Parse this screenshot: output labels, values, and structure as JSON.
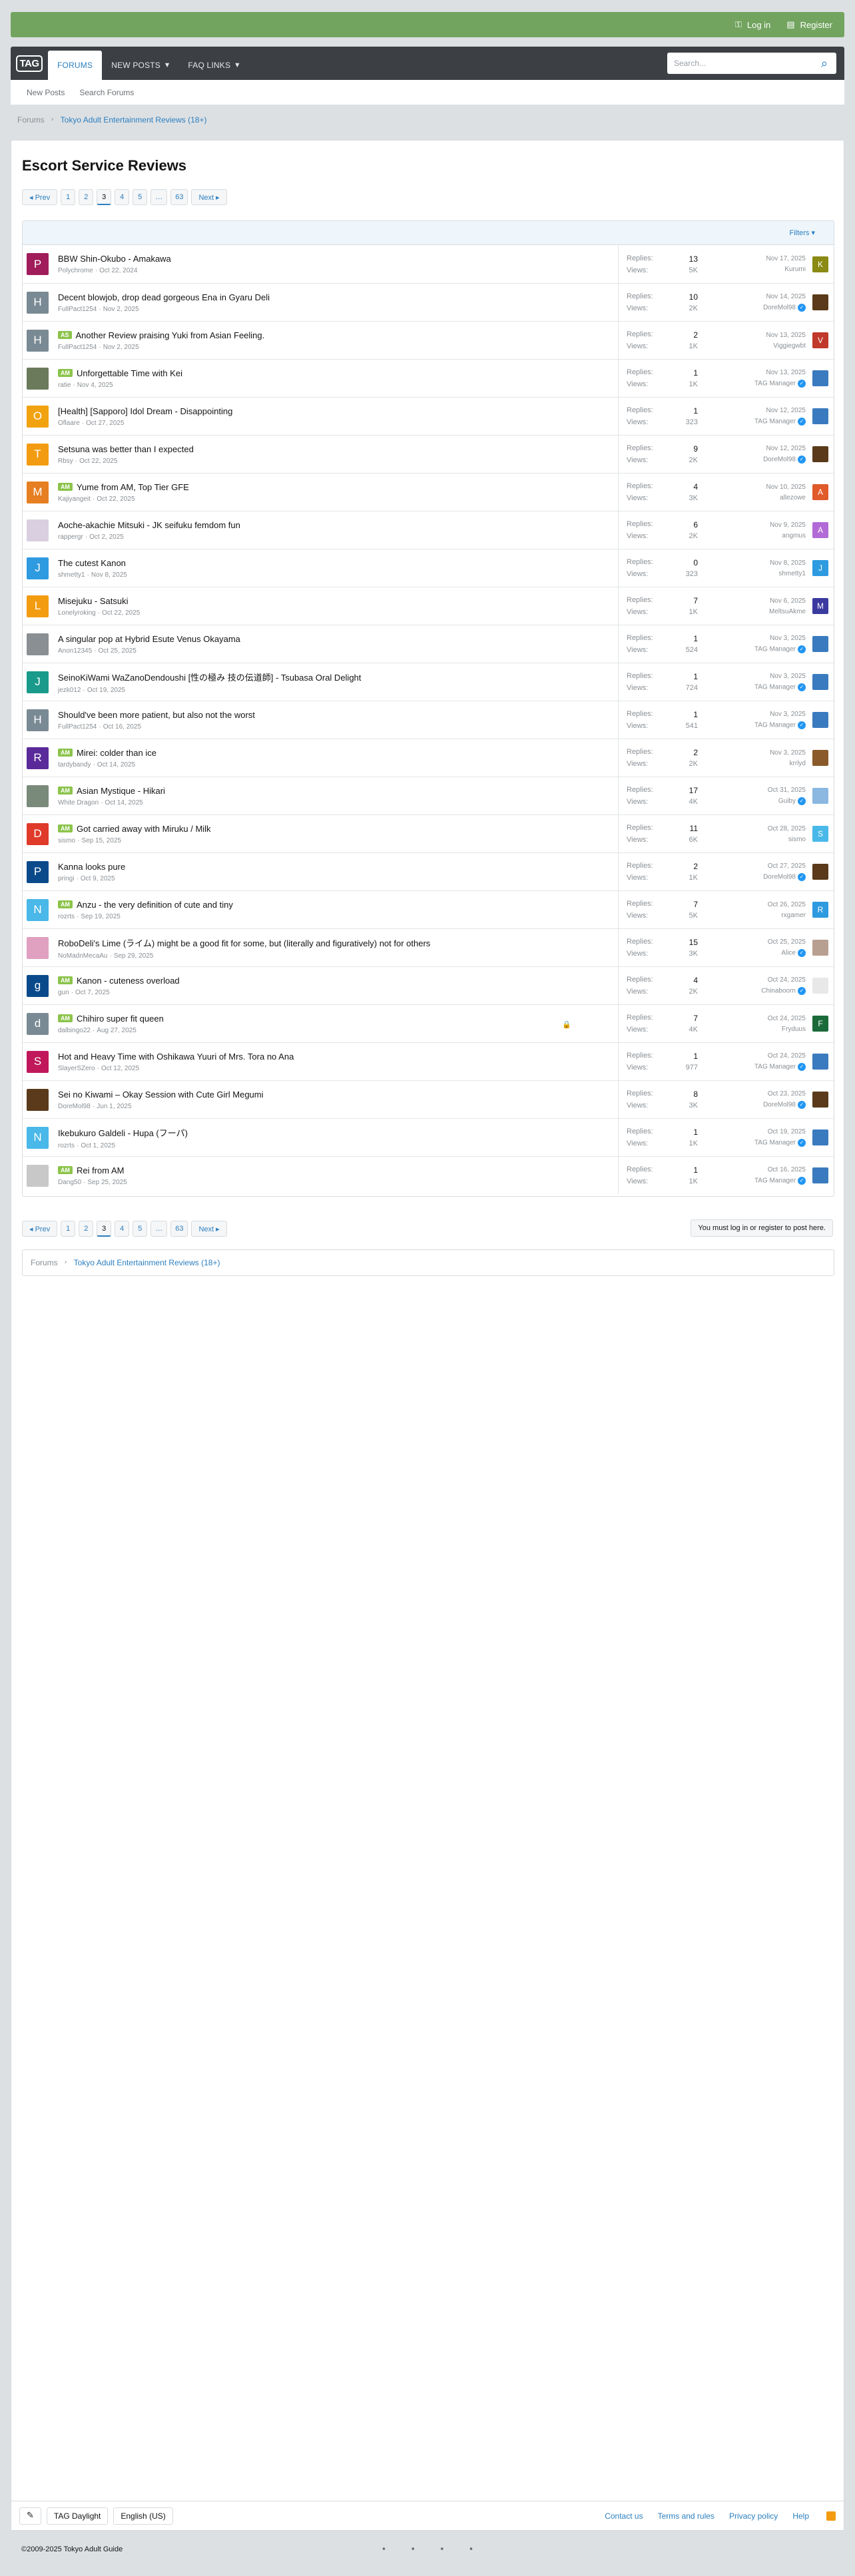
{
  "topbar": {
    "login": "Log in",
    "register": "Register",
    "login_icon": "key-icon",
    "register_icon": "register-icon"
  },
  "nav": {
    "logo": "TAG",
    "tabs": [
      {
        "label": "FORUMS",
        "selected": true
      },
      {
        "label": "NEW POSTS",
        "dropdown": true
      },
      {
        "label": "FAQ LINKS",
        "dropdown": true
      }
    ],
    "search_placeholder": "Search..."
  },
  "subnav": {
    "items": [
      "New Posts",
      "Search Forums"
    ]
  },
  "breadcrumb": {
    "root": "Forums",
    "current": "Tokyo Adult Entertainment Reviews (18+)"
  },
  "page": {
    "title": "Escort Service Reviews"
  },
  "pagination": {
    "prev": "◂ Prev",
    "pages": [
      "1",
      "2",
      "3",
      "4",
      "5",
      "…",
      "63"
    ],
    "current": "3",
    "next": "Next ▸"
  },
  "filters": {
    "label": "Filters ▾"
  },
  "labels": {
    "replies": "Replies:",
    "views": "Views:",
    "login_note": "You must log in or register to post here."
  },
  "threads": [
    {
      "title": "BBW Shin-Okubo - Amakawa",
      "tag": "",
      "author": "Polychrome",
      "date": "Oct 22, 2024",
      "replies": "13",
      "views": "5K",
      "last_date": "Nov 17, 2025",
      "last_user": "Kurumi",
      "verified": false,
      "av_letter": "P",
      "av_color": "#a01c5a",
      "av2_letter": "K",
      "av2_color": "#8a8a14",
      "locked": false
    },
    {
      "title": "Decent blowjob, drop dead gorgeous Ena in Gyaru Deli",
      "tag": "",
      "author": "FullPact1254",
      "date": "Nov 2, 2025",
      "replies": "10",
      "views": "2K",
      "last_date": "Nov 14, 2025",
      "last_user": "DoreMol98",
      "verified": true,
      "av_letter": "H",
      "av_color": "#7a8a94",
      "av2_letter": "",
      "av2_color": "#5a3a1a",
      "locked": false
    },
    {
      "title": "Another Review praising Yuki from Asian Feeling.",
      "tag": "AS",
      "author": "FullPact1254",
      "date": "Nov 2, 2025",
      "replies": "2",
      "views": "1K",
      "last_date": "Nov 13, 2025",
      "last_user": "Viggiegwbt",
      "verified": false,
      "av_letter": "H",
      "av_color": "#7a8a94",
      "av2_letter": "V",
      "av2_color": "#c0392b",
      "locked": false
    },
    {
      "title": "Unforgettable Time with Kei",
      "tag": "AM",
      "author": "ratie",
      "date": "Nov 4, 2025",
      "replies": "1",
      "views": "1K",
      "last_date": "Nov 13, 2025",
      "last_user": "TAG Manager",
      "verified": true,
      "av_letter": "",
      "av_color": "#6b7a5a",
      "av2_letter": "",
      "av2_color": "#3a7abf",
      "locked": false
    },
    {
      "title": "[Health] [Sapporo] Idol Dream - Disappointing",
      "tag": "",
      "author": "Oflaare",
      "date": "Oct 27, 2025",
      "replies": "1",
      "views": "323",
      "last_date": "Nov 12, 2025",
      "last_user": "TAG Manager",
      "verified": true,
      "av_letter": "O",
      "av_color": "#f1a20f",
      "av2_letter": "",
      "av2_color": "#3a7abf",
      "locked": false
    },
    {
      "title": "Setsuna was better than I expected",
      "tag": "",
      "author": "Rbsy",
      "date": "Oct 22, 2025",
      "replies": "9",
      "views": "2K",
      "last_date": "Nov 12, 2025",
      "last_user": "DoreMol98",
      "verified": true,
      "av_letter": "T",
      "av_color": "#f39c12",
      "av2_letter": "",
      "av2_color": "#5a3a1a",
      "locked": false
    },
    {
      "title": "Yume from AM, Top Tier GFE",
      "tag": "AM",
      "author": "Kajiyangeit",
      "date": "Oct 22, 2025",
      "replies": "4",
      "views": "3K",
      "last_date": "Nov 10, 2025",
      "last_user": "allezowe",
      "verified": false,
      "av_letter": "M",
      "av_color": "#e67e22",
      "av2_letter": "A",
      "av2_color": "#e05a2a",
      "locked": false
    },
    {
      "title": "Aoche-akachie Mitsuki - JK seifuku femdom fun",
      "tag": "",
      "author": "rappergr",
      "date": "Oct 2, 2025",
      "replies": "6",
      "views": "2K",
      "last_date": "Nov 9, 2025",
      "last_user": "angmus",
      "verified": false,
      "av_letter": "",
      "av_color": "#d9cfe0",
      "av2_letter": "A",
      "av2_color": "#b26ad6",
      "locked": false
    },
    {
      "title": "The cutest Kanon",
      "tag": "",
      "author": "shmetty1",
      "date": "Nov 8, 2025",
      "replies": "0",
      "views": "323",
      "last_date": "Nov 8, 2025",
      "last_user": "shmetty1",
      "verified": false,
      "av_letter": "J",
      "av_color": "#2e9ae0",
      "av2_letter": "J",
      "av2_color": "#2e9ae0",
      "locked": false
    },
    {
      "title": "Misejuku - Satsuki",
      "tag": "",
      "author": "Lonelyroking",
      "date": "Oct 22, 2025",
      "replies": "7",
      "views": "1K",
      "last_date": "Nov 6, 2025",
      "last_user": "MeltsuAkme",
      "verified": false,
      "av_letter": "L",
      "av_color": "#f39c12",
      "av2_letter": "M",
      "av2_color": "#3a3aa0",
      "locked": false
    },
    {
      "title": "A singular pop at Hybrid Esute Venus Okayama",
      "tag": "",
      "author": "Anon12345",
      "date": "Oct 25, 2025",
      "replies": "1",
      "views": "524",
      "last_date": "Nov 3, 2025",
      "last_user": "TAG Manager",
      "verified": true,
      "av_letter": "",
      "av_color": "#8a8f94",
      "av2_letter": "",
      "av2_color": "#3a7abf",
      "locked": false
    },
    {
      "title": "SeinoKiWami WaZanoDendoushi [性の極み 技の伝道師] - Tsubasa Oral Delight",
      "tag": "",
      "author": "jezk012",
      "date": "Oct 19, 2025",
      "replies": "1",
      "views": "724",
      "last_date": "Nov 3, 2025",
      "last_user": "TAG Manager",
      "verified": true,
      "av_letter": "J",
      "av_color": "#1a9a8a",
      "av2_letter": "",
      "av2_color": "#3a7abf",
      "locked": false
    },
    {
      "title": "Should've been more patient, but also not the worst",
      "tag": "",
      "author": "FullPact1254",
      "date": "Oct 16, 2025",
      "replies": "1",
      "views": "541",
      "last_date": "Nov 3, 2025",
      "last_user": "TAG Manager",
      "verified": true,
      "av_letter": "H",
      "av_color": "#7a8a94",
      "av2_letter": "",
      "av2_color": "#3a7abf",
      "locked": false
    },
    {
      "title": "Mirei: colder than ice",
      "tag": "AM",
      "author": "tardybandy",
      "date": "Oct 14, 2025",
      "replies": "2",
      "views": "2K",
      "last_date": "Nov 3, 2025",
      "last_user": "krrlyd",
      "verified": false,
      "av_letter": "R",
      "av_color": "#5a2a9a",
      "av2_letter": "",
      "av2_color": "#8a5a2a",
      "locked": false
    },
    {
      "title": "Asian Mystique - Hikari",
      "tag": "AM",
      "author": "White Dragon",
      "date": "Oct 14, 2025",
      "replies": "17",
      "views": "4K",
      "last_date": "Oct 31, 2025",
      "last_user": "Guiby",
      "verified": true,
      "av_letter": "",
      "av_color": "#7a8a7a",
      "av2_letter": "",
      "av2_color": "#8ab8e0",
      "locked": false
    },
    {
      "title": "Got carried away with Miruku / Milk",
      "tag": "AM",
      "author": "sismo",
      "date": "Sep 15, 2025",
      "replies": "11",
      "views": "6K",
      "last_date": "Oct 28, 2025",
      "last_user": "sismo",
      "verified": false,
      "av_letter": "D",
      "av_color": "#e03a2a",
      "av2_letter": "S",
      "av2_color": "#4ab8e8",
      "locked": false
    },
    {
      "title": "Kanna looks pure",
      "tag": "",
      "author": "pringi",
      "date": "Oct 9, 2025",
      "replies": "2",
      "views": "1K",
      "last_date": "Oct 27, 2025",
      "last_user": "DoreMol98",
      "verified": true,
      "av_letter": "P",
      "av_color": "#0a4a8a",
      "av2_letter": "",
      "av2_color": "#5a3a1a",
      "locked": false
    },
    {
      "title": "Anzu - the very definition of cute and tiny",
      "tag": "AM",
      "author": "rozrts",
      "date": "Sep 19, 2025",
      "replies": "7",
      "views": "5K",
      "last_date": "Oct 26, 2025",
      "last_user": "rxgamer",
      "verified": false,
      "av_letter": "N",
      "av_color": "#4ab8e8",
      "av2_letter": "R",
      "av2_color": "#2e9ae0",
      "locked": false
    },
    {
      "title": "RoboDeli's Lime (ライム) might be a good fit for some, but (literally and figuratively) not for others",
      "tag": "",
      "author": "NoMadnMecaAu",
      "date": "Sep 29, 2025",
      "replies": "15",
      "views": "3K",
      "last_date": "Oct 25, 2025",
      "last_user": "Alice",
      "verified": true,
      "av_letter": "",
      "av_color": "#e0a0c0",
      "av2_letter": "",
      "av2_color": "#b8a090",
      "locked": false
    },
    {
      "title": "Kanon - cuteness overload",
      "tag": "AM",
      "author": "gun",
      "date": "Oct 7, 2025",
      "replies": "4",
      "views": "2K",
      "last_date": "Oct 24, 2025",
      "last_user": "Chinaboorn",
      "verified": true,
      "av_letter": "g",
      "av_color": "#0a4a8a",
      "av2_letter": "",
      "av2_color": "#e8e8e8",
      "locked": false
    },
    {
      "title": "Chihiro super fit queen",
      "tag": "AM",
      "author": "dalbingo22",
      "date": "Aug 27, 2025",
      "replies": "7",
      "views": "4K",
      "last_date": "Oct 24, 2025",
      "last_user": "Fryduus",
      "verified": false,
      "av_letter": "d",
      "av_color": "#7a8a94",
      "av2_letter": "F",
      "av2_color": "#1a6a3a",
      "locked": true
    },
    {
      "title": "Hot and Heavy Time with Oshikawa Yuuri of Mrs. Tora no Ana",
      "tag": "",
      "author": "SlayerSZero",
      "date": "Oct 12, 2025",
      "replies": "1",
      "views": "977",
      "last_date": "Oct 24, 2025",
      "last_user": "TAG Manager",
      "verified": true,
      "av_letter": "S",
      "av_color": "#c0185a",
      "av2_letter": "",
      "av2_color": "#3a7abf",
      "locked": false
    },
    {
      "title": "Sei no Kiwami – Okay Session with Cute Girl Megumi",
      "tag": "",
      "author": "DoreMol98",
      "date": "Jun 1, 2025",
      "replies": "8",
      "views": "3K",
      "last_date": "Oct 23, 2025",
      "last_user": "DoreMol98",
      "verified": true,
      "av_letter": "",
      "av_color": "#5a3a1a",
      "av2_letter": "",
      "av2_color": "#5a3a1a",
      "locked": false
    },
    {
      "title": "Ikebukuro Galdeli - Hupa (フーパ)",
      "tag": "",
      "author": "rozrts",
      "date": "Oct 1, 2025",
      "replies": "1",
      "views": "1K",
      "last_date": "Oct 19, 2025",
      "last_user": "TAG Manager",
      "verified": true,
      "av_letter": "N",
      "av_color": "#4ab8e8",
      "av2_letter": "",
      "av2_color": "#3a7abf",
      "locked": false
    },
    {
      "title": "Rei from AM",
      "tag": "AM",
      "author": "Dang50",
      "date": "Sep 25, 2025",
      "replies": "1",
      "views": "1K",
      "last_date": "Oct 16, 2025",
      "last_user": "TAG Manager",
      "verified": true,
      "av_letter": "",
      "av_color": "#c8c8c8",
      "av2_letter": "",
      "av2_color": "#3a7abf",
      "locked": false
    }
  ],
  "footer": {
    "edit_icon": "pencil-icon",
    "style": "TAG Daylight",
    "language": "English (US)",
    "links": [
      "Contact us",
      "Terms and rules",
      "Privacy policy",
      "Help"
    ],
    "rss_icon": "rss-icon",
    "copyright": "©2009-2025 Tokyo Adult Guide"
  }
}
